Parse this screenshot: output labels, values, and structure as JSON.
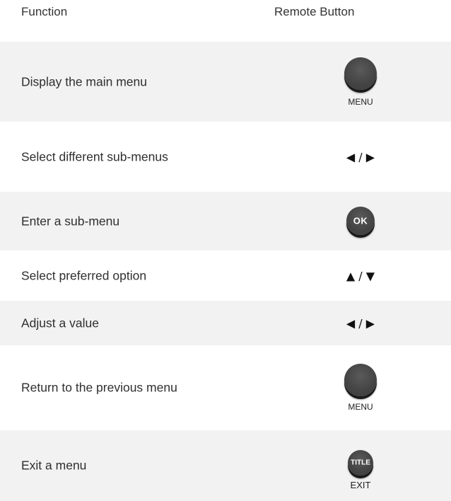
{
  "header": {
    "function_label": "Function",
    "button_label": "Remote Button"
  },
  "rows": [
    {
      "function": "Display the main menu",
      "button_type": "round",
      "button_icon": "menu-button-icon",
      "button_text": "",
      "caption": "MENU"
    },
    {
      "function": "Select different sub-menus",
      "button_type": "arrows",
      "button_text": "◀ / ▶"
    },
    {
      "function": "Enter a sub-menu",
      "button_type": "round",
      "button_icon": "ok-button-icon",
      "button_text": "OK",
      "caption": ""
    },
    {
      "function": "Select preferred option",
      "button_type": "arrows",
      "button_text": "▲ / ▼"
    },
    {
      "function": "Adjust a value",
      "button_type": "arrows",
      "button_text": "◀ / ▶"
    },
    {
      "function": "Return to the previous menu",
      "button_type": "round",
      "button_icon": "menu-button-icon",
      "button_text": "",
      "caption": "MENU"
    },
    {
      "function": "Exit a menu",
      "button_type": "round",
      "button_icon": "title-exit-button-icon",
      "button_text": "TITLE",
      "caption": "EXIT"
    }
  ],
  "colors": {
    "shaded_row": "#f2f2f2",
    "button": "#454545",
    "text": "#2f2f2f"
  }
}
